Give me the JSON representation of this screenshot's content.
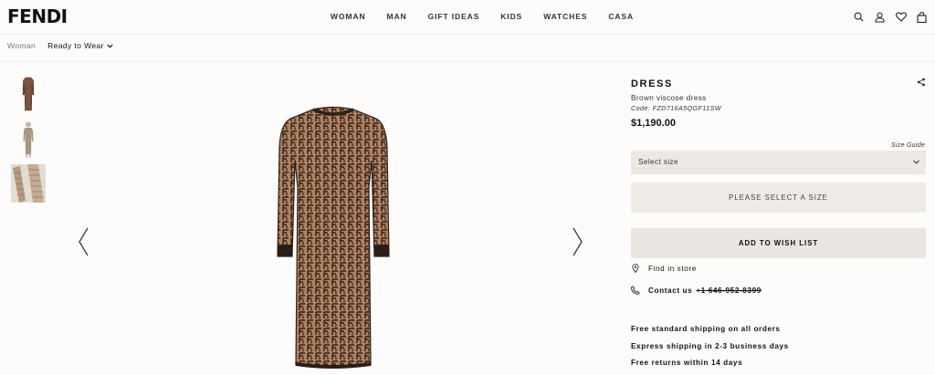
{
  "brand": {
    "logo": "FENDI"
  },
  "nav": {
    "items": [
      {
        "label": "WOMAN"
      },
      {
        "label": "MAN"
      },
      {
        "label": "GIFT IDEAS"
      },
      {
        "label": "KIDS"
      },
      {
        "label": "WATCHES"
      },
      {
        "label": "CASA"
      }
    ]
  },
  "header_icons": [
    "search-icon",
    "account-icon",
    "wishlist-heart-icon",
    "shopping-bag-icon"
  ],
  "breadcrumb": {
    "level1": "Woman",
    "level2": "Ready to Wear"
  },
  "gallery": {
    "thumbnails": [
      "dress-thumbnail-front",
      "dress-thumbnail-model",
      "dress-thumbnail-detail"
    ],
    "prev_icon": "chevron-left-icon",
    "next_icon": "chevron-right-icon"
  },
  "product": {
    "title": "DRESS",
    "description": "Brown viscose dress",
    "code": "Code: FZD716A5QGF11SW",
    "price": "$1,190.00",
    "size_guide": "Size Guide",
    "size_select_placeholder": "Select size",
    "select_size_button": "PLEASE SELECT A SIZE",
    "wishlist_button": "ADD TO WISH LIST",
    "find_in_store": "Find in store",
    "contact_label": "Contact us",
    "contact_phone": "+1 646-952-8399",
    "shipping_info": [
      "Free standard shipping on all orders",
      "Express shipping in 2-3 business days",
      "Free returns within 14 days"
    ]
  },
  "colors": {
    "background": "#fdfcfa",
    "button_bg": "#eeebe7",
    "dress_dark": "#2e211a",
    "dress_light": "#b08160"
  }
}
